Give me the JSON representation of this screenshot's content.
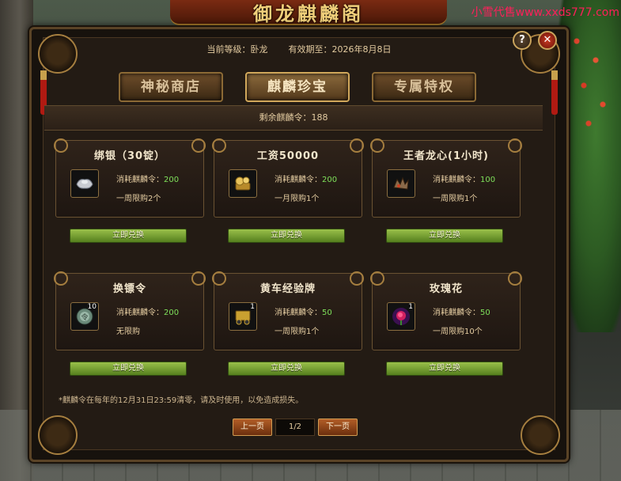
{
  "banner": {
    "title": "御龙麒麟阁"
  },
  "watermark": "小雪代售www.xxds777.com",
  "header": {
    "level_text": "当前等级：卧龙",
    "expiry_text": "有效期至：2026年8月8日",
    "help_label": "?",
    "close_label": "✕"
  },
  "tabs": [
    {
      "label": "神秘商店",
      "active": false
    },
    {
      "label": "麒麟珍宝",
      "active": true
    },
    {
      "label": "专属特权",
      "active": false
    }
  ],
  "remaining": "剩余麒麟令：188",
  "items": [
    {
      "name": "绑银（30锭）",
      "cost_label": "消耗麒麟令：",
      "cost": "200",
      "limit": "一周限购2个",
      "count": "",
      "icon": "silver-ingot-icon",
      "button": "立即兑换"
    },
    {
      "name": "工资50000",
      "cost_label": "消耗麒麟令：",
      "cost": "200",
      "limit": "一月限购1个",
      "count": "",
      "icon": "gold-coins-icon",
      "button": "立即兑换"
    },
    {
      "name": "王者龙心(1小时)",
      "cost_label": "消耗麒麟令：",
      "cost": "100",
      "limit": "一周限购1个",
      "count": "",
      "icon": "dragon-heart-icon",
      "button": "立即兑换"
    },
    {
      "name": "换镖令",
      "cost_label": "消耗麒麟令：",
      "cost": "200",
      "limit": "无限购",
      "count": "10",
      "icon": "escort-token-icon",
      "button": "立即兑换"
    },
    {
      "name": "黄车经验牌",
      "cost_label": "消耗麒麟令：",
      "cost": "50",
      "limit": "一周限购1个",
      "count": "1",
      "icon": "yellow-cart-icon",
      "button": "立即兑换"
    },
    {
      "name": "玫瑰花",
      "cost_label": "消耗麒麟令：",
      "cost": "50",
      "limit": "一周限购10个",
      "count": "1",
      "icon": "rose-icon",
      "button": "立即兑换"
    }
  ],
  "note": "*麒麟令在每年的12月31日23:59清零，请及时使用，以免造成损失。",
  "pager": {
    "prev": "上一页",
    "page": "1/2",
    "next": "下一页"
  },
  "colors": {
    "cost_value": "#7ee05a",
    "button_green": "#7aa636",
    "accent_gold": "#d1a85b"
  }
}
